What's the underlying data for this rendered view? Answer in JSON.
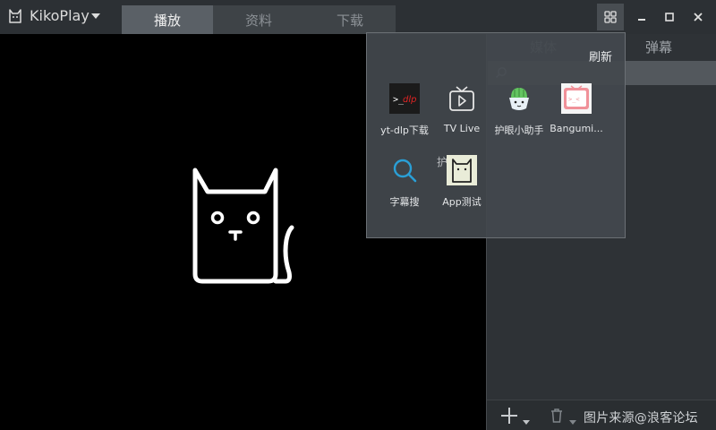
{
  "app": {
    "title": "KikoPlay"
  },
  "tabs": [
    {
      "label": "播放",
      "active": true
    },
    {
      "label": "资料",
      "active": false
    },
    {
      "label": "下载",
      "active": false
    }
  ],
  "right_panel": {
    "tabs": [
      {
        "label": "媒体"
      },
      {
        "label": "弹幕"
      }
    ],
    "search": {
      "placeholder": "",
      "value": ""
    }
  },
  "apps_popup": {
    "refresh_label": "刷新",
    "ghost_label": "护",
    "apps": [
      {
        "name": "yt-dlp下载",
        "icon": "yt-dlp-icon"
      },
      {
        "name": "TV Live",
        "icon": "tv-icon"
      },
      {
        "name": "护眼小助手",
        "icon": "eye-care-icon"
      },
      {
        "name": "Bangumi...",
        "icon": "bangumi-icon"
      },
      {
        "name": "字幕搜",
        "icon": "subtitle-search-icon"
      },
      {
        "name": "App测试",
        "icon": "app-test-icon"
      }
    ]
  },
  "watermark": "图片来源@浪客论坛",
  "colors": {
    "accent_blue": "#2a9fd6",
    "bangumi_pink": "#f09199",
    "player_bg": "#000000"
  }
}
